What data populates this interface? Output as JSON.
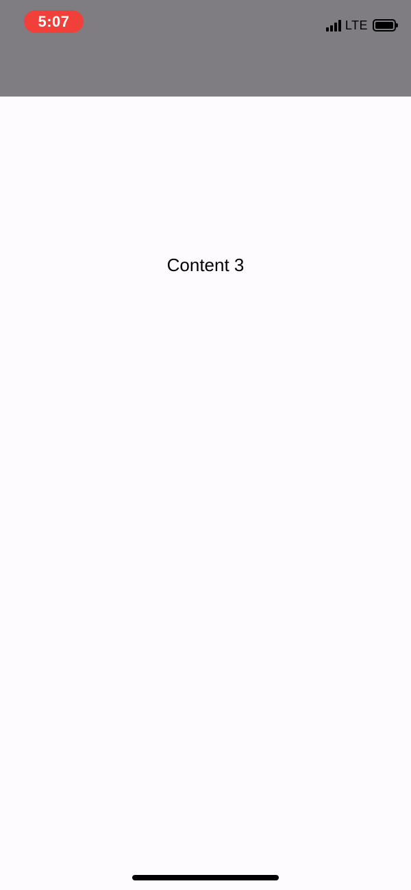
{
  "status_bar": {
    "time": "5:07",
    "network": "LTE",
    "signal_icon": "cellular-signal-icon",
    "battery_icon": "battery-icon",
    "colors": {
      "background": "#7f7d82",
      "time_pill": "#f1403a"
    }
  },
  "main": {
    "label": "Content 3"
  },
  "colors": {
    "page_background": "#fdfbfe",
    "text": "#000000"
  }
}
